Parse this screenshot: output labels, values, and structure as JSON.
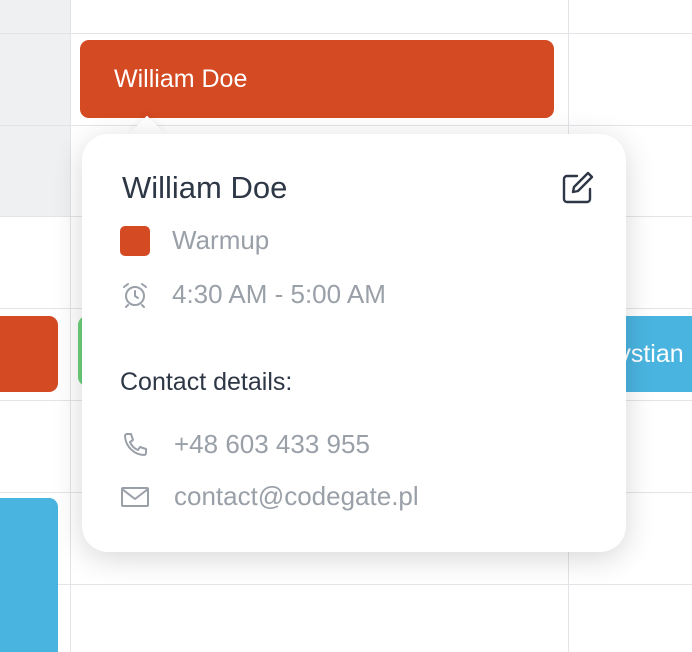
{
  "event": {
    "title": "William Doe",
    "color": "#d44a22"
  },
  "background_events": [
    {
      "label": "",
      "color": "#d44a22"
    },
    {
      "label": "",
      "color": "#6cd07a"
    },
    {
      "label": "rystian",
      "color": "#4ab4e0"
    },
    {
      "label": "",
      "color": "#4ab4e0"
    }
  ],
  "popup": {
    "title": "William Doe",
    "edit_icon": "edit-icon",
    "category": {
      "label": "Warmup",
      "color": "#d44a22"
    },
    "time": {
      "icon": "alarm-clock-icon",
      "label": "4:30 AM - 5:00 AM"
    },
    "contact_heading": "Contact details:",
    "phone": {
      "icon": "phone-icon",
      "value": "+48 603 433 955"
    },
    "email": {
      "icon": "mail-icon",
      "value": "contact@codegate.pl"
    }
  }
}
